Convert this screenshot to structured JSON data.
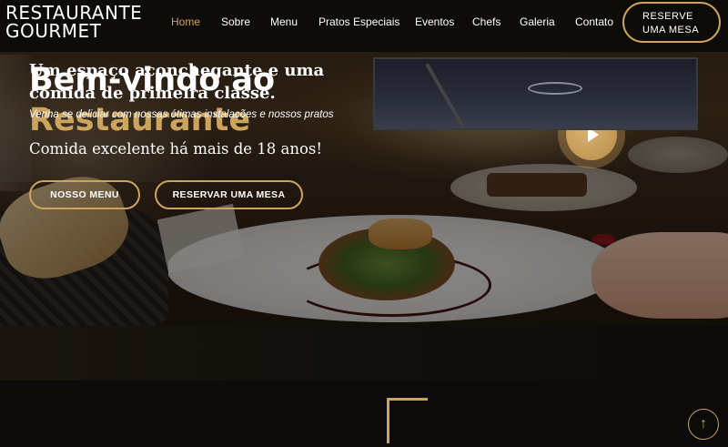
{
  "header": {
    "logo_line1": "RESTAURANTE",
    "logo_line2": "GOURMET",
    "nav": [
      {
        "label": "Home",
        "active": true
      },
      {
        "label": "Sobre",
        "active": false
      },
      {
        "label": "Menu",
        "active": false
      },
      {
        "label": "Pratos Especiais",
        "active": false
      },
      {
        "label": "Eventos",
        "active": false
      },
      {
        "label": "Chefs",
        "active": false
      },
      {
        "label": "Galeria",
        "active": false
      },
      {
        "label": "Contato",
        "active": false
      }
    ],
    "reserve_line1": "RESERVE",
    "reserve_line2": "UMA MESA"
  },
  "hero": {
    "title_line1": "Bem-vindo ao",
    "title_line2": "Restaurante",
    "subtitle": "Comida excelente há mais de 18 anos!",
    "btn_menu": "NOSSO MENU",
    "btn_reservar": "RESERVAR UMA MESA",
    "play_icon": "play-icon"
  },
  "about": {
    "title": "Um espaço aconchegante e uma comida de primeira classe.",
    "text": "Venha se deliciar com nossas ótimas instalações e nossos pratos"
  },
  "scroll_top_icon": "arrow-up-icon",
  "colors": {
    "accent": "#cda45e",
    "background": "#0c0b09",
    "text": "#ffffff"
  }
}
